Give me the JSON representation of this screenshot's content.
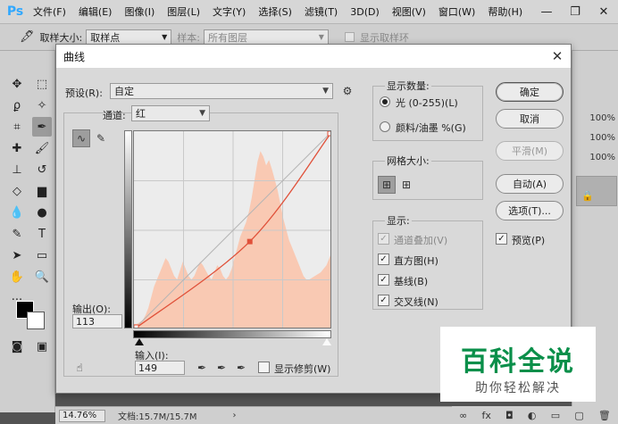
{
  "app": {
    "logo": "Ps",
    "menus": [
      "文件(F)",
      "编辑(E)",
      "图像(I)",
      "图层(L)",
      "文字(Y)",
      "选择(S)",
      "滤镜(T)",
      "3D(D)",
      "视图(V)",
      "窗口(W)",
      "帮助(H)"
    ],
    "window_controls": [
      "—",
      "❐",
      "✕"
    ]
  },
  "options_bar": {
    "sample_size_label": "取样大小:",
    "sample_size_value": "取样点",
    "sample_label": "样本:",
    "sample_value": "所有图层",
    "show_ring_label": "显示取样环"
  },
  "right_panel": {
    "percents": [
      "100%",
      "100%",
      "100%"
    ]
  },
  "status": {
    "zoom": "14.76%",
    "doc_info": "文档:15.7M/15.7M"
  },
  "dialog": {
    "title": "曲线",
    "close": "✕",
    "preset_label": "预设(R):",
    "preset_value": "自定",
    "channel_label": "通道:",
    "channel_value": "红",
    "output_label": "输出(O):",
    "output_value": "113",
    "input_label": "输入(I):",
    "input_value": "149",
    "show_clipping_label": "显示修剪(W)",
    "display_amount": {
      "title": "显示数量:",
      "options": [
        "光 (0-255)(L)",
        "颜料/油墨 %(G)"
      ],
      "selected": 0
    },
    "grid_size": {
      "title": "网格大小:"
    },
    "show": {
      "title": "显示:",
      "items": [
        {
          "label": "通道叠加(V)",
          "checked": true,
          "disabled": true
        },
        {
          "label": "直方图(H)",
          "checked": true,
          "disabled": false
        },
        {
          "label": "基线(B)",
          "checked": true,
          "disabled": false
        },
        {
          "label": "交叉线(N)",
          "checked": true,
          "disabled": false
        }
      ]
    },
    "buttons": {
      "ok": "确定",
      "cancel": "取消",
      "smooth": "平滑(M)",
      "auto": "自动(A)",
      "options": "选项(T)..."
    },
    "preview_label": "预览(P)",
    "preview_checked": true,
    "colors": {
      "curve": "#e0513a",
      "histogram": "#f9c9b3",
      "graph_bg": "#ececec"
    }
  },
  "curve": {
    "input_range": [
      0,
      255
    ],
    "output_range": [
      0,
      255
    ],
    "points": [
      [
        0,
        0
      ],
      [
        149,
        113
      ],
      [
        255,
        255
      ]
    ],
    "selected_point": [
      149,
      113
    ],
    "histogram": [
      3,
      3,
      4,
      5,
      8,
      12,
      18,
      24,
      28,
      32,
      36,
      40,
      38,
      34,
      30,
      28,
      33,
      38,
      34,
      30,
      28,
      30,
      34,
      38,
      36,
      33,
      30,
      28,
      32,
      36,
      34,
      30,
      28,
      30,
      34,
      40,
      46,
      52,
      56,
      60,
      66,
      74,
      84,
      94,
      100,
      97,
      92,
      95,
      90,
      84,
      78,
      70,
      62,
      56,
      50,
      46,
      42,
      38,
      34,
      30,
      28,
      28,
      29,
      30,
      31,
      32,
      34,
      36,
      40,
      44
    ]
  },
  "watermark": {
    "main": "百科全说",
    "sub": "助你轻松解决"
  }
}
